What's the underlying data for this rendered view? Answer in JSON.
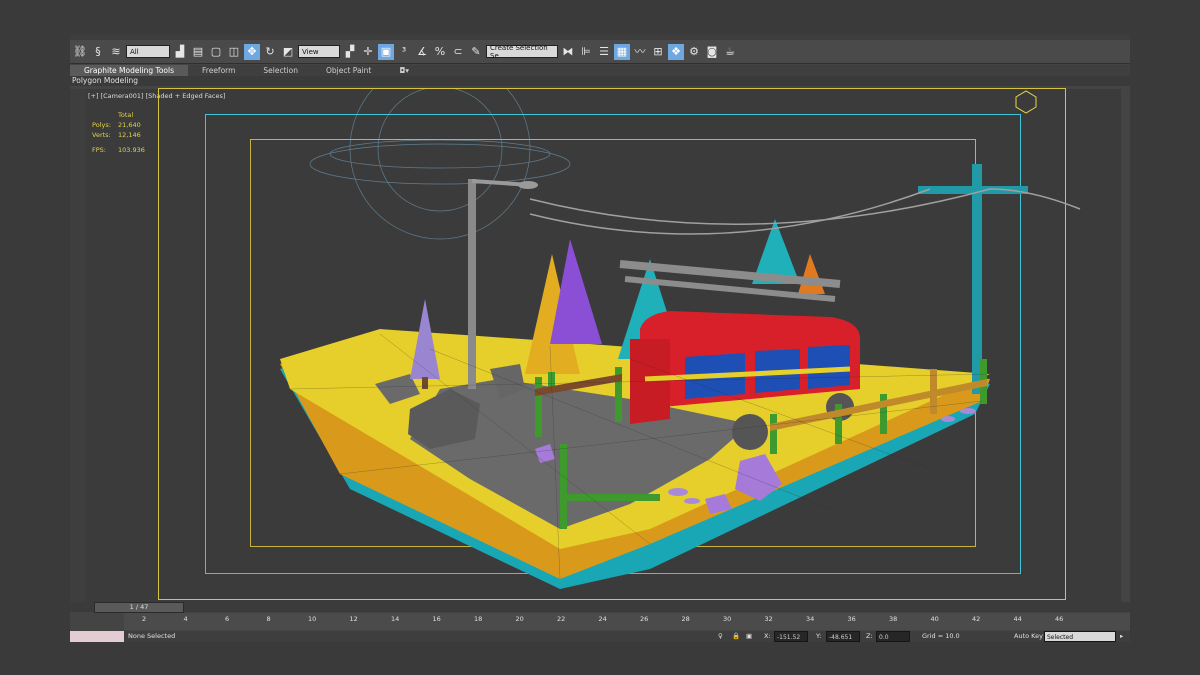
{
  "toolbar": {
    "selection_filter": "All",
    "reference_coord": "View",
    "named_selection_placeholder": "Create Selection Se"
  },
  "ribbon": {
    "tabs": [
      "Graphite Modeling Tools",
      "Freeform",
      "Selection",
      "Object Paint"
    ],
    "sub_label": "Polygon Modeling"
  },
  "viewport": {
    "label": "[+] [Camera001] [Shaded + Edged Faces]",
    "stats": {
      "total_label": "Total",
      "polys_label": "Polys:",
      "polys_value": "21,640",
      "verts_label": "Verts:",
      "verts_value": "12,146",
      "fps_label": "FPS:",
      "fps_value": "103.936"
    }
  },
  "timeline": {
    "slider_label": "1 / 47",
    "ticks": [
      "2",
      "4",
      "6",
      "8",
      "10",
      "12",
      "14",
      "16",
      "18",
      "20",
      "22",
      "24",
      "26",
      "28",
      "30",
      "32",
      "34",
      "36",
      "38",
      "40",
      "42",
      "44",
      "46"
    ]
  },
  "status": {
    "selection_text": "None Selected",
    "x_label": "X:",
    "x_value": "-151.52",
    "y_label": "Y:",
    "y_value": "-48.651",
    "z_label": "Z:",
    "z_value": "0.0",
    "grid_text": "Grid = 10.0",
    "autokey_label": "Auto Key",
    "autokey_value": "Selected"
  },
  "colors": {
    "ground_yellow": "#e8d02a",
    "soil_orange": "#e39a1e",
    "soil_cyan": "#1fb5c4",
    "bus_red": "#d8202a",
    "bus_blue": "#1d4fb5",
    "tree_purple": "#8a4fd4",
    "tree_lilac": "#9a86d0",
    "tree_cyan": "#1fb0ba",
    "pole_teal": "#1f9aa6",
    "fence_green": "#3f9a2e",
    "safe_frame": "#d6c43e",
    "camera_frame": "#3cc6d6"
  }
}
